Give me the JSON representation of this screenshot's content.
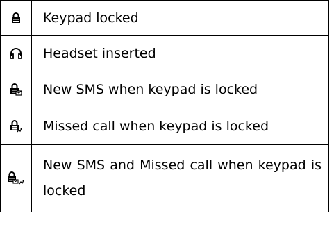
{
  "rows": [
    {
      "icon": "lock-icon",
      "description": "Keypad locked"
    },
    {
      "icon": "headset-icon",
      "description": "Headset inserted"
    },
    {
      "icon": "lock-sms-icon",
      "description": "New SMS when keypad is locked"
    },
    {
      "icon": "lock-missed-call-icon",
      "description": "Missed call when keypad is locked"
    },
    {
      "icon": "lock-sms-missed-call-icon",
      "description": "New SMS and Missed call when keypad is locked"
    }
  ]
}
